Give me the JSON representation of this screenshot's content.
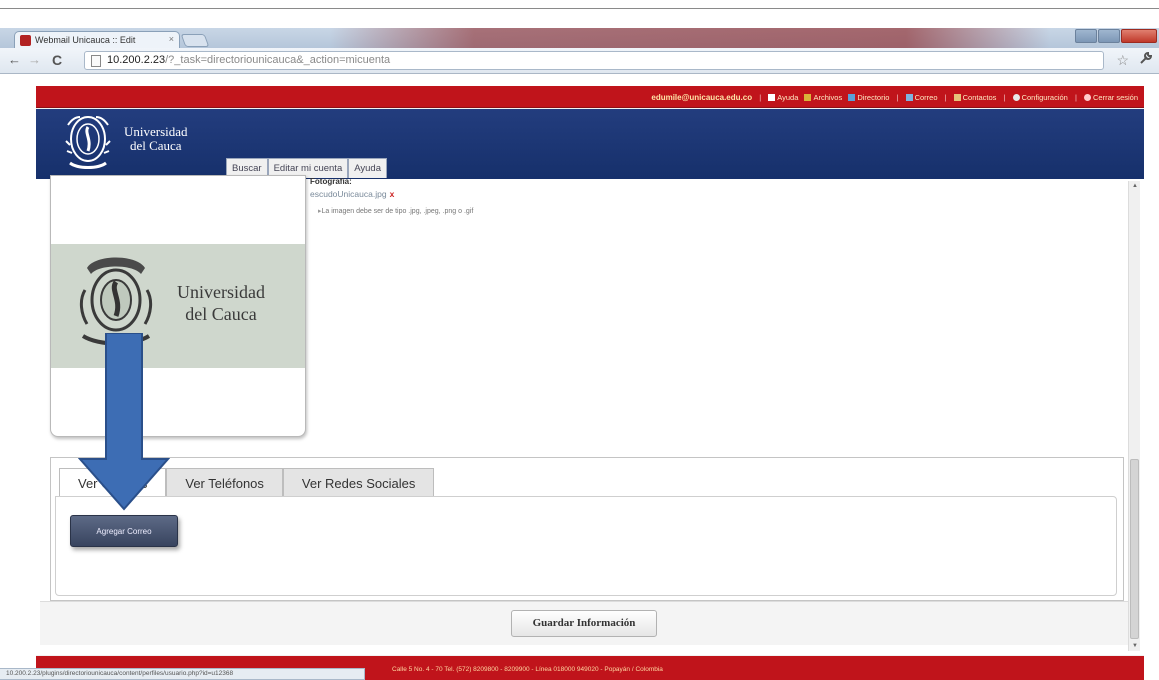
{
  "browser": {
    "tab_title": "Webmail Unicauca :: Edit",
    "tab_close": "×",
    "url_host": "10.200.2.23",
    "url_path": "/?_task=directoriounicauca&_action=micuenta",
    "back_glyph": "←",
    "forward_glyph": "→",
    "reload_glyph": "C",
    "star_glyph": "☆",
    "wrench_glyph": "🔧",
    "status_text": "10.200.2.23/plugins/directoriounicauca/content/perfiles/usuario.php?id=u12368"
  },
  "userbar": {
    "email": "edumile@unicauca.edu.co",
    "separator": "|",
    "items": [
      "Ayuda",
      "Archivos",
      "Directorio",
      "Correo",
      "Contactos",
      "Configuración",
      "Cerrar sesión"
    ]
  },
  "header": {
    "logo_line1": "Universidad",
    "logo_line2": "del Cauca",
    "menu_tabs": [
      "Buscar",
      "Editar mi cuenta",
      "Ayuda"
    ]
  },
  "photo_section": {
    "label": "Fotografía:",
    "filename": "escudoUnicauca.jpg",
    "remove_glyph": "x",
    "hint": "La imagen debe ser de tipo .jpg, .jpeg, .png o .gif",
    "photo_line1": "Universidad",
    "photo_line2": "del Cauca"
  },
  "contact_tabs": {
    "tabs": [
      "Ver Correos",
      "Ver Teléfonos",
      "Ver Redes Sociales"
    ],
    "active": 0,
    "add_email_button": "Agregar Correo"
  },
  "save_button": "Guardar Información",
  "footer_text": "Calle 5 No. 4 - 70 Tel. (572) 8209800 - 8209900 - Línea 018000 949020 - Popayán / Colombia",
  "colors": {
    "brand_red": "#c0141b",
    "brand_blue": "#1b357a",
    "annotation_arrow": "#3d6db4"
  }
}
